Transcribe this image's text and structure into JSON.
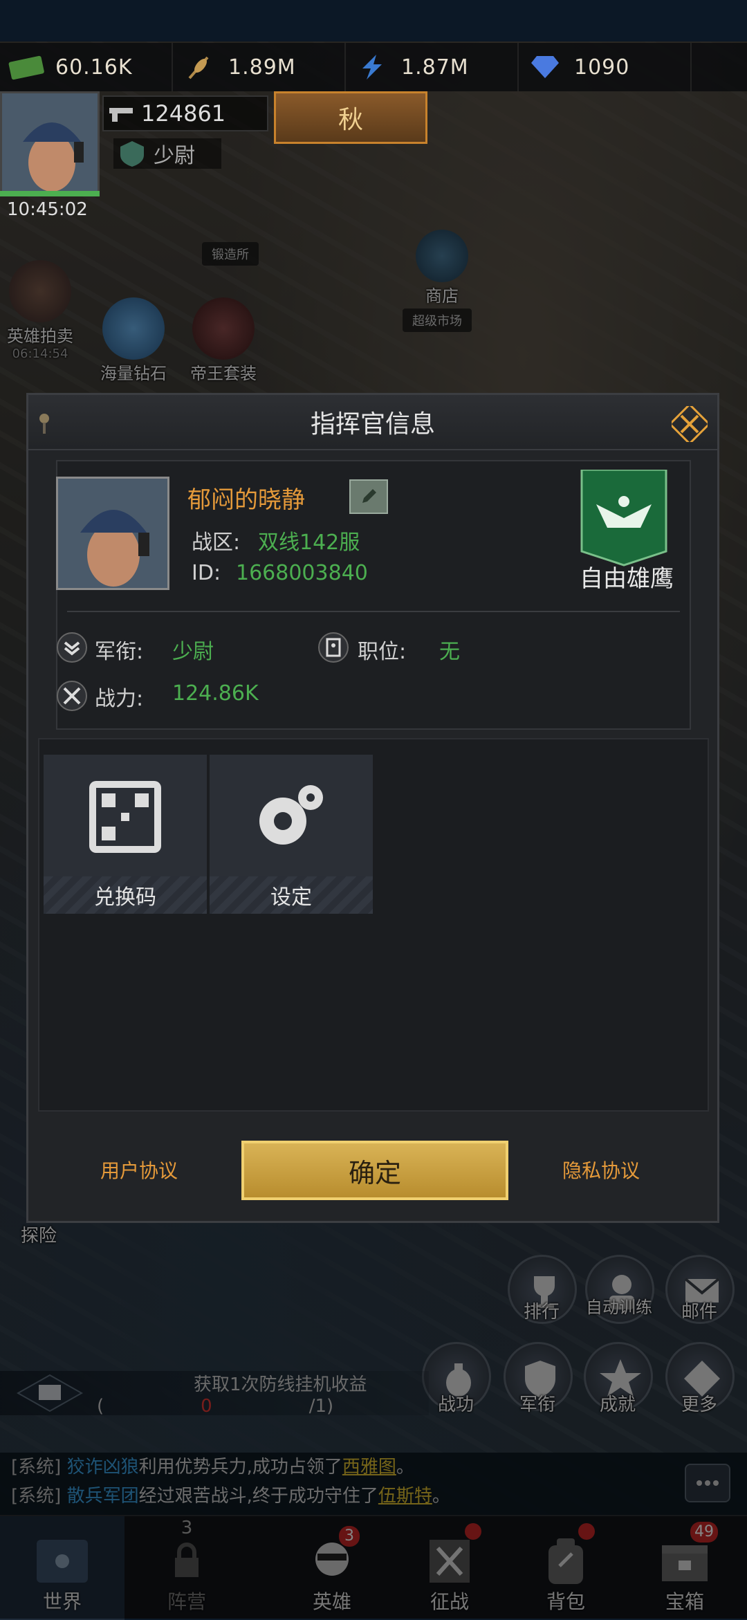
{
  "resources": [
    {
      "icon": "cash-icon",
      "value": "60.16K"
    },
    {
      "icon": "wheat-icon",
      "value": "1.89M"
    },
    {
      "icon": "lightning-icon",
      "value": "1.87M"
    },
    {
      "icon": "diamond-icon",
      "value": "1090"
    }
  ],
  "player": {
    "power_top": "124861",
    "season": "秋",
    "rank_top": "少尉",
    "clock": "10:45:02"
  },
  "map_labels": {
    "forge": "锻造所",
    "shop": "商店",
    "supermarket": "超级市场"
  },
  "side_events": [
    {
      "label": "英雄拍卖",
      "sub": "06:14:54"
    },
    {
      "label": "海量钻石"
    },
    {
      "label": "帝王套装"
    }
  ],
  "dialog": {
    "title": "指挥官信息",
    "name": "郁闷的晓静",
    "zone_label": "战区:",
    "zone_value": "双线142服",
    "id_label": "ID:",
    "id_value": "1668003840",
    "guild_name": "自由雄鹰",
    "rank_label": "军衔:",
    "rank_value": "少尉",
    "position_label": "职位:",
    "position_value": "无",
    "power_label": "战力:",
    "power_value": "124.86K",
    "tiles": [
      {
        "label": "兑换码"
      },
      {
        "label": "设定"
      }
    ],
    "user_agreement": "用户协议",
    "confirm": "确定",
    "privacy": "隐私协议"
  },
  "task": {
    "prefix": "获取1次防线挂机收益(",
    "count": "0",
    "suffix": "/1)"
  },
  "right_buttons": [
    {
      "label": "排行"
    },
    {
      "label": "自动训练"
    },
    {
      "label": "邮件"
    },
    {
      "label": "战功"
    },
    {
      "label": "军衔"
    },
    {
      "label": "成就"
    },
    {
      "label": "更多"
    }
  ],
  "explore": "探险",
  "chat": [
    {
      "tag": "[系统]",
      "name": "狡诈凶狼",
      "text": "利用优势兵力,成功占领了",
      "place": "西雅图",
      "end": "。"
    },
    {
      "tag": "[系统]",
      "name": "散兵军团",
      "text": "经过艰苦战斗,终于成功守住了",
      "place": "伍斯特",
      "end": "。"
    }
  ],
  "nav": [
    {
      "label": "世界",
      "badge": ""
    },
    {
      "label": "阵营",
      "badge": "3"
    },
    {
      "label": "英雄",
      "badge": "3"
    },
    {
      "label": "征战",
      "badge": ""
    },
    {
      "label": "背包",
      "badge": ""
    },
    {
      "label": "宝箱",
      "badge": "49"
    }
  ],
  "colors": {
    "accent_orange": "#e59a3a",
    "value_green": "#4caf50",
    "confirm_gold": "#d9b356",
    "badge_red": "#c62828"
  }
}
